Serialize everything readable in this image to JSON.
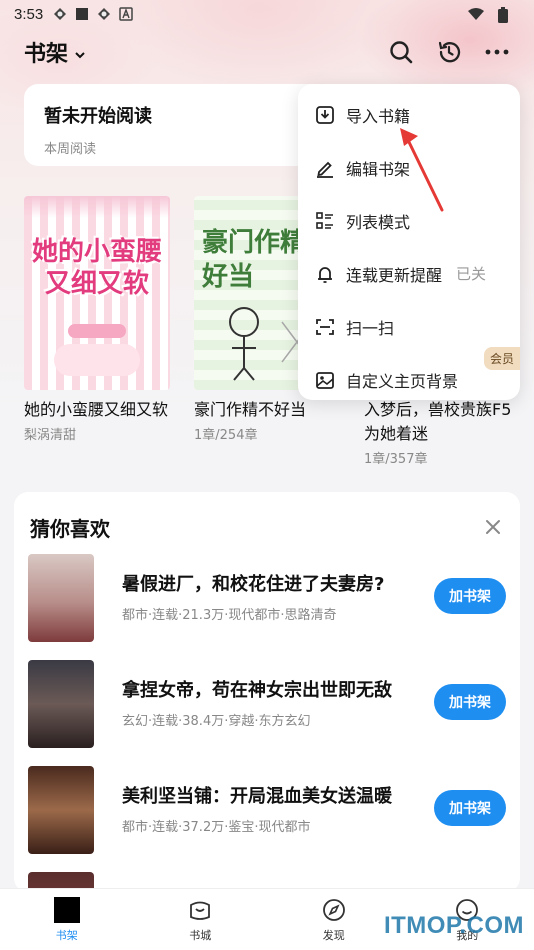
{
  "status_bar": {
    "time": "3:53"
  },
  "header": {
    "title": "书架"
  },
  "reading_card": {
    "title": "暂未开始阅读",
    "subtitle": "本周阅读"
  },
  "books": [
    {
      "cover_text": "她的小蛮腰又细又软",
      "title": "她的小蛮腰又细又软",
      "sub": "梨涡清甜"
    },
    {
      "cover_text": "豪门作精不好当",
      "title": "豪门作精不好当",
      "sub": "1章/254章"
    },
    {
      "title": "入梦后，兽校贵族F5为她着迷",
      "sub": "1章/357章"
    }
  ],
  "menu": {
    "items": [
      {
        "label": "导入书籍",
        "icon": "import-icon"
      },
      {
        "label": "编辑书架",
        "icon": "edit-icon"
      },
      {
        "label": "列表模式",
        "icon": "list-icon"
      },
      {
        "label": "连载更新提醒",
        "icon": "bell-icon",
        "value": "已关"
      },
      {
        "label": "扫一扫",
        "icon": "scan-icon"
      },
      {
        "label": "自定义主页背景",
        "icon": "image-icon",
        "badge": "会员"
      }
    ]
  },
  "guess": {
    "title": "猜你喜欢",
    "items": [
      {
        "title": "暑假进厂，和校花住进了夫妻房?",
        "meta": "都市·连载·21.3万·现代都市·思路清奇",
        "button": "加书架"
      },
      {
        "title": "拿捏女帝，苟在神女宗出世即无敌",
        "meta": "玄幻·连载·38.4万·穿越·东方玄幻",
        "button": "加书架"
      },
      {
        "title": "美利坚当铺：开局混血美女送温暖",
        "meta": "都市·连载·37.2万·鉴宝·现代都市",
        "button": "加书架"
      }
    ]
  },
  "tabs": [
    {
      "label": "书架",
      "active": true
    },
    {
      "label": "书城"
    },
    {
      "label": "发现"
    },
    {
      "label": "我的"
    }
  ],
  "watermark": "ITMOP.COM",
  "colors": {
    "accent": "#1f8ef1",
    "arrow": "#e53935"
  }
}
